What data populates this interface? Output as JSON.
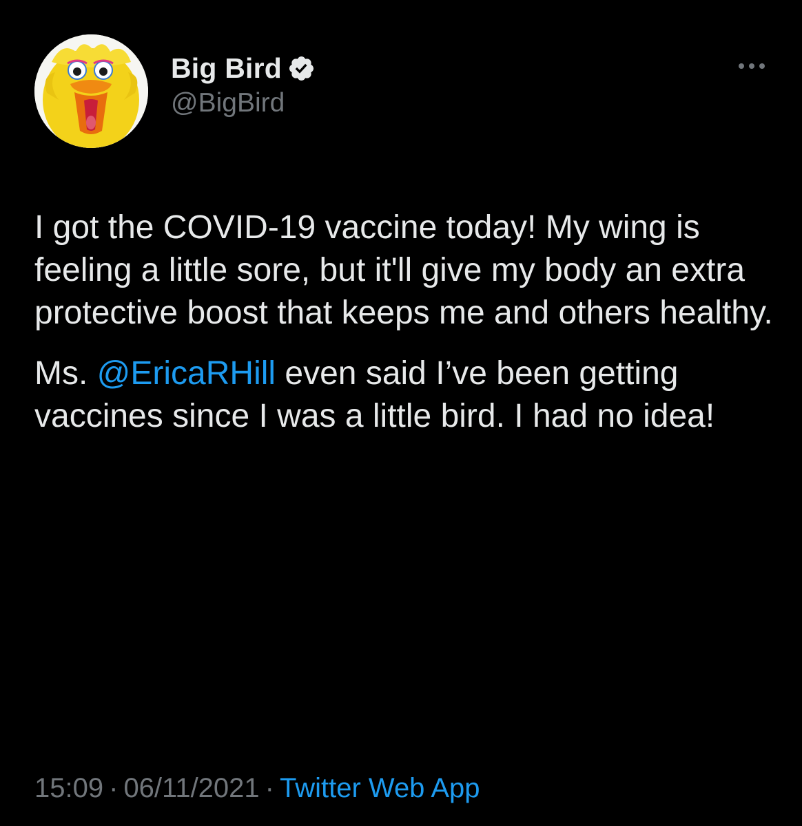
{
  "author": {
    "display_name": "Big Bird",
    "handle": "@BigBird",
    "verified": true,
    "avatar": "big-bird-avatar"
  },
  "tweet": {
    "line1_text": "I got the COVID-19 vaccine today! My wing is feeling a little sore, but it'll give my body an extra protective boost that keeps me and others healthy.",
    "line2_prefix": "Ms. ",
    "line2_mention": "@EricaRHill",
    "line2_suffix": " even said I’ve been getting vaccines since I was a little bird. I had no idea!"
  },
  "meta": {
    "time": "15:09",
    "date": "06/11/2021",
    "source": "Twitter Web App",
    "separator": "·"
  },
  "colors": {
    "background": "#000000",
    "text": "#e7e9ea",
    "secondary": "#71767b",
    "accent": "#1d9bf0"
  },
  "icons": {
    "verified": "verified-badge-icon",
    "more": "more-options-icon"
  }
}
